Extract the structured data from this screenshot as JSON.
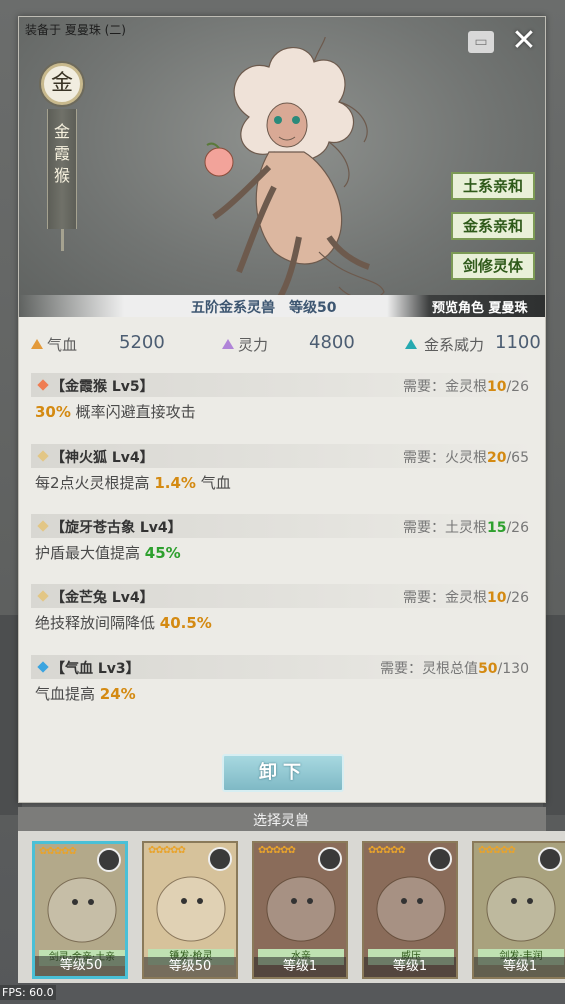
{
  "header": {
    "equipped_on": "装备于 夏曼珠 (二)",
    "element_char": "金",
    "beast_name": "金霞猴",
    "affinities": [
      "土系亲和",
      "金系亲和",
      "剑修灵体"
    ],
    "rank": "五阶金系灵兽　等级50",
    "preview": "预览角色 夏曼珠"
  },
  "stats": [
    {
      "label": "气血",
      "value": "5200",
      "color": "#e39a3a"
    },
    {
      "label": "灵力",
      "value": "4800",
      "color": "#b084d8"
    },
    {
      "label": "金系威力",
      "value": "1100",
      "color": "#26a9b0"
    }
  ],
  "traits": [
    {
      "name": "【金霞猴 Lv5】",
      "diamond": "#ef7d52",
      "req_label": "需要：",
      "req_stat": "金灵根",
      "req_cur": "10",
      "req_sep": "/",
      "req_max": "26",
      "req_cur_color": "orange",
      "desc_pre": "",
      "desc_hl": "30%",
      "desc_post": " 概率闪避直接攻击",
      "hl_color": "orange"
    },
    {
      "name": "【神火狐 Lv4】",
      "diamond": "#e2c685",
      "req_label": "需要：",
      "req_stat": "火灵根",
      "req_cur": "20",
      "req_sep": "/",
      "req_max": "65",
      "req_cur_color": "orange",
      "desc_pre": "每2点火灵根提高 ",
      "desc_hl": "1.4%",
      "desc_post": " 气血",
      "hl_color": "orange"
    },
    {
      "name": "【旋牙苍古象 Lv4】",
      "diamond": "#e2c685",
      "req_label": "需要：",
      "req_stat": "土灵根",
      "req_cur": "15",
      "req_sep": "/",
      "req_max": "26",
      "req_cur_color": "green",
      "desc_pre": "护盾最大值提高 ",
      "desc_hl": "45%",
      "desc_post": "",
      "hl_color": "green"
    },
    {
      "name": "【金芒兔 Lv4】",
      "diamond": "#e2c685",
      "req_label": "需要：",
      "req_stat": "金灵根",
      "req_cur": "10",
      "req_sep": "/",
      "req_max": "26",
      "req_cur_color": "orange",
      "desc_pre": "绝技释放间隔降低 ",
      "desc_hl": "40.5%",
      "desc_post": "",
      "hl_color": "orange"
    },
    {
      "name": "【气血 Lv3】",
      "diamond": "#3aa4e0",
      "req_label": "需要：",
      "req_stat": "灵根总值",
      "req_cur": "50",
      "req_sep": "/",
      "req_max": "130",
      "req_cur_color": "orange",
      "desc_pre": "气血提高 ",
      "desc_hl": "24%",
      "desc_post": "",
      "hl_color": "orange"
    }
  ],
  "unequip_label": "卸下",
  "select_title": "选择灵兽",
  "cards": [
    {
      "tag": "剑灵·金亲·土亲",
      "level": "等级50",
      "selected": true,
      "bg": "#b3a98a"
    },
    {
      "tag": "锤发·枪灵",
      "level": "等级50",
      "selected": false,
      "bg": "#d6c29b"
    },
    {
      "tag": "水亲",
      "level": "等级1",
      "selected": false,
      "bg": "#8a6c5a"
    },
    {
      "tag": "威压",
      "level": "等级1",
      "selected": false,
      "bg": "#8a6c5a"
    },
    {
      "tag": "剑发·丰润",
      "level": "等级1",
      "selected": false,
      "bg": "#a9a27e"
    }
  ],
  "fps": "FPS: 60.0"
}
